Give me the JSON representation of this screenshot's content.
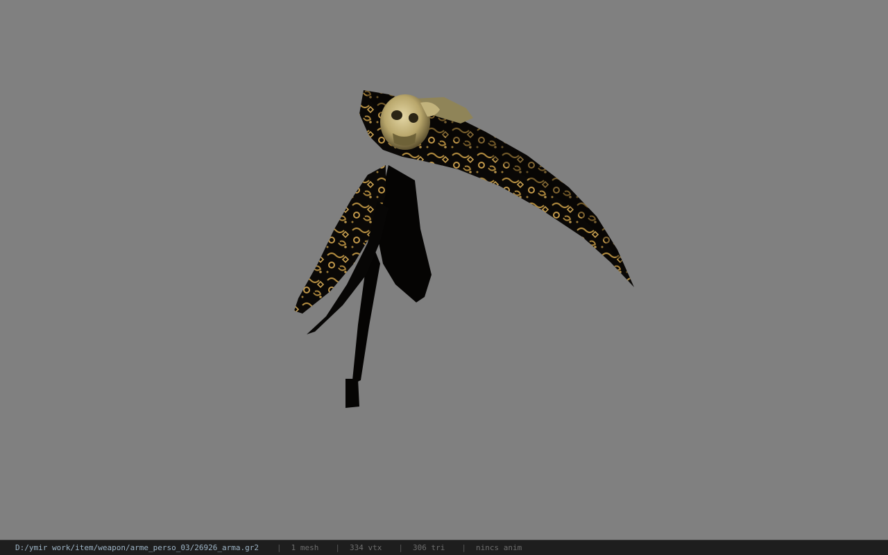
{
  "viewer": {
    "background_color": "#808080",
    "model_name": "scythe-model"
  },
  "statusbar": {
    "file_path": "D:/ymir work/item/weapon/arme_perso_03/26926_arma.gr2",
    "separator": "|",
    "mesh_count": "1 mesh",
    "vertex_count": "334 vtx",
    "triangle_count": "306 tri",
    "animation": "nincs anim"
  },
  "colors": {
    "blade_dark": "#0a0806",
    "ornament_gold": "#b8944a",
    "skull_bone": "#cfc08a",
    "statusbar_bg": "#1e1e1e"
  }
}
